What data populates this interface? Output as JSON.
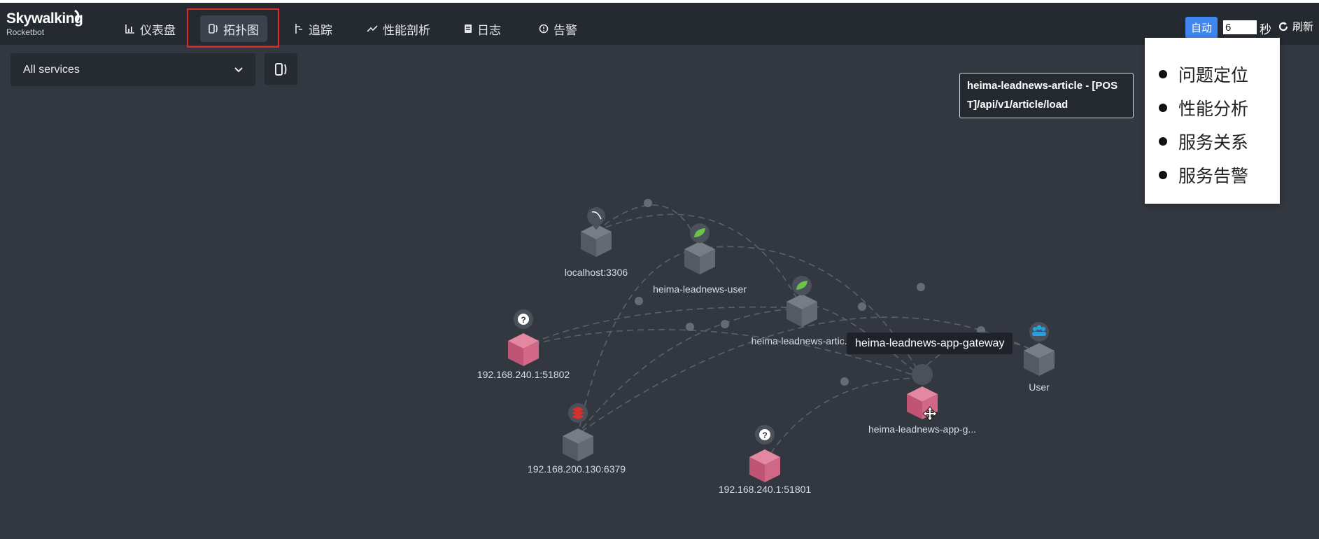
{
  "app": {
    "logo_title": "Skywalking",
    "logo_subtitle": "Rocketbot"
  },
  "nav": [
    {
      "label": "仪表盘",
      "icon": "bar-chart-icon",
      "active": false
    },
    {
      "label": "拓扑图",
      "icon": "topology-icon",
      "active": true
    },
    {
      "label": "追踪",
      "icon": "trace-icon",
      "active": false
    },
    {
      "label": "性能剖析",
      "icon": "line-chart-icon",
      "active": false
    },
    {
      "label": "日志",
      "icon": "log-icon",
      "active": false
    },
    {
      "label": "告警",
      "icon": "alarm-icon",
      "active": false
    }
  ],
  "toolbar": {
    "auto_label": "自动",
    "interval_value": "6",
    "seconds_label": "秒",
    "refresh_label": "刷新"
  },
  "filter": {
    "service_select_value": "All services"
  },
  "popup_menu": {
    "items": [
      "问题定位",
      "性能分析",
      "服务关系",
      "服务告警"
    ]
  },
  "endpoint_tooltip": {
    "line1": "heima-leadnews-article - [POS",
    "line2": "T]/api/v1/article/load"
  },
  "hover_tooltip": "heima-leadnews-app-gateway",
  "topology": {
    "nodes": [
      {
        "label": "localhost:3306",
        "kind": "database",
        "icon": "mysql-dolphin-icon"
      },
      {
        "label": "heima-leadnews-user",
        "kind": "service",
        "icon": "spring-leaf-icon"
      },
      {
        "label": "heima-leadnews-artic...",
        "kind": "service",
        "icon": "spring-leaf-icon"
      },
      {
        "label": "192.168.240.1:51802",
        "kind": "unknown",
        "icon": "question-mark-icon"
      },
      {
        "label": "User",
        "kind": "user",
        "icon": "users-icon"
      },
      {
        "label": "heima-leadnews-app-g...",
        "kind": "gateway",
        "icon": "gateway-icon"
      },
      {
        "label": "192.168.200.130:6379",
        "kind": "cache",
        "icon": "redis-icon"
      },
      {
        "label": "192.168.240.1:51801",
        "kind": "unknown",
        "icon": "question-mark-icon"
      }
    ]
  },
  "colors": {
    "background": "#333840",
    "navbar": "#252a31",
    "accent": "#3f86f0",
    "highlight": "#e12b2b",
    "node_gray": "#5c626b",
    "node_pink": "#d45f7e",
    "spring_green": "#6cc24a",
    "redis_red": "#d8302c",
    "users_blue": "#2aa0e3"
  }
}
